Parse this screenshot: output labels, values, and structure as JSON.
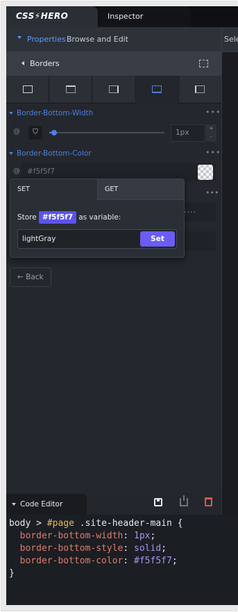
{
  "header": {
    "logo_text": "CSS",
    "logo_bolt": "⚡",
    "logo_text2": "HERO",
    "inspector_tab": "Inspector"
  },
  "properties_bar": {
    "title": "Properties",
    "subtitle": "Browse and Edit",
    "right_label": "Sele"
  },
  "section": {
    "title": "Borders"
  },
  "side_tabs": [
    "all-sides-icon",
    "top-side-icon",
    "right-side-icon",
    "bottom-side-icon",
    "left-side-icon"
  ],
  "border_bottom_width": {
    "label": "Border-Bottom-Width",
    "value": "1px",
    "slider_fraction": 0.02,
    "step_up": "+",
    "step_down": "-"
  },
  "border_bottom_color": {
    "label": "Border-Bottom-Color",
    "value": "#f5f5f7",
    "swatch_color": "#f5f5f7"
  },
  "hidden_row": {
    "value": "...."
  },
  "back_button": "← Back",
  "popover": {
    "tab_set": "SET",
    "tab_get": "GET",
    "store_prefix": "Store",
    "store_value": "#f5f5f7",
    "store_suffix": "as variable:",
    "variable_name": "lightGray",
    "set_button": "Set"
  },
  "code_editor": {
    "title": "Code Editor",
    "line1_sel": "body > ",
    "line1_id": "#page",
    "line1_rest": " .site-header-main {",
    "lines": [
      {
        "prop": "border-bottom-width",
        "value": "1px"
      },
      {
        "prop": "border-bottom-style",
        "value": "solid"
      },
      {
        "prop": "border-bottom-color",
        "value": "#f5f5f7"
      }
    ],
    "closing": "}"
  },
  "colors": {
    "accent_blue": "#4d7fe0",
    "accent_purple": "#6c5cf2",
    "panel_bg": "#24272d",
    "danger": "#e0564a"
  }
}
